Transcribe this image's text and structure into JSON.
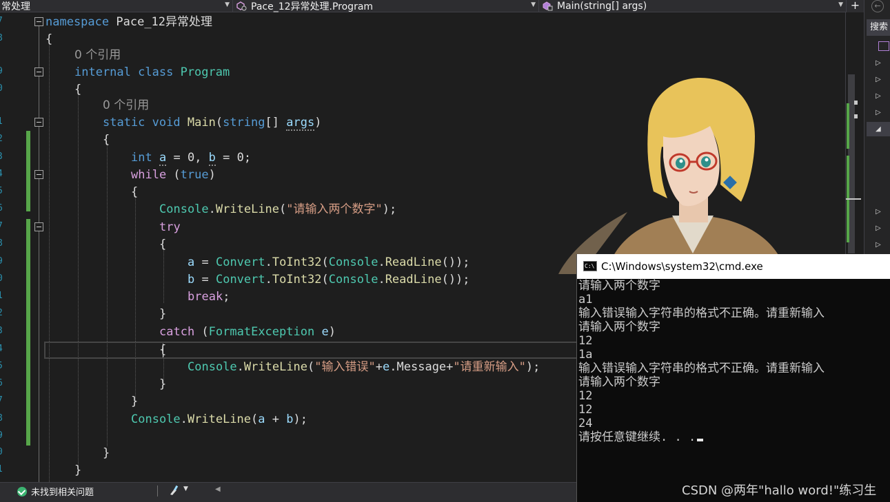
{
  "navbar": {
    "project": "常处理",
    "type_scope": "Pace_12异常处理.Program",
    "member_scope": "Main(string[] args)",
    "split_button": "+"
  },
  "gutter": {
    "line_numbers": [
      "7",
      "8",
      "9",
      "0",
      "1",
      "2",
      "3",
      "4",
      "5",
      "6",
      "7",
      "8",
      "9",
      "0",
      "1",
      "2",
      "3",
      "4",
      "5",
      "6",
      "7",
      "8",
      "9",
      "0",
      "1"
    ]
  },
  "code": {
    "namespace_kw": "namespace",
    "namespace_name": "Pace_12异常处理",
    "open_brace": "{",
    "close_brace": "}",
    "refs_label_class": "0 个引用",
    "internal_kw": "internal",
    "class_kw": "class",
    "class_name": "Program",
    "refs_label_main": "0 个引用",
    "static_kw": "static",
    "void_kw": "void",
    "main_name": "Main",
    "string_kw": "string",
    "brackets": "[]",
    "args_name": "args",
    "int_kw": "int",
    "var_a": "a",
    "var_b": "b",
    "zero": "0",
    "while_kw": "while",
    "true_kw": "true",
    "console": "Console",
    "writeline": "WriteLine",
    "prompt_string": "\"请输入两个数字\"",
    "try_kw": "try",
    "convert": "Convert",
    "toint32": "ToInt32",
    "readline": "ReadLine",
    "break_kw": "break",
    "catch_kw": "catch",
    "exception_type": "FormatException",
    "exception_var": "e",
    "error_string": "\"输入错误\"",
    "message_prop": "Message",
    "retry_string": "\"请重新输入\""
  },
  "side_panel": {
    "search_label": "搜索",
    "back_icon": "back-circle-icon"
  },
  "status": {
    "issues_text": "未找到相关问题"
  },
  "console": {
    "title": "C:\\Windows\\system32\\cmd.exe",
    "icon_text": "C:\\",
    "lines": [
      "请输入两个数字",
      "a1",
      "输入错误输入字符串的格式不正确。请重新输入",
      "请输入两个数字",
      "12",
      "1a",
      "输入错误输入字符串的格式不正确。请重新输入",
      "请输入两个数字",
      "12",
      "12",
      "24",
      "请按任意键继续. . ."
    ]
  },
  "watermark": "CSDN @两年\"hallo word!\"练习生",
  "colors": {
    "keyword": "#569cd6",
    "control": "#d8a0df",
    "type": "#4ec9b0",
    "method": "#dcdcaa",
    "string": "#d69d85",
    "variable": "#9cdcfe",
    "change_bar": "#57a64a",
    "editor_bg": "#1e1e1e",
    "console_bg": "#0c0c0c"
  }
}
